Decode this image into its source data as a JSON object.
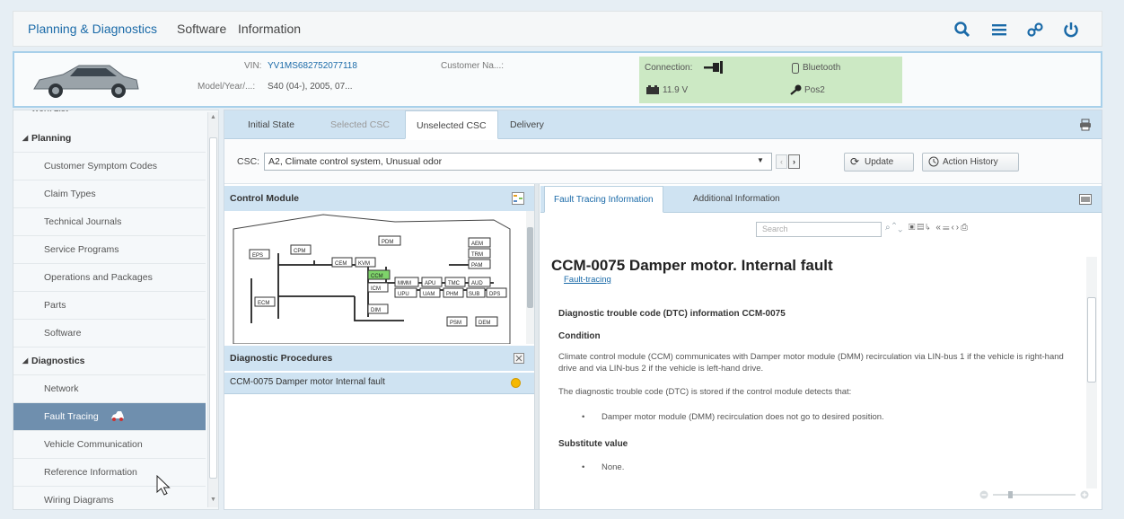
{
  "topbar": {
    "menu": [
      "Planning & Diagnostics",
      "Software",
      "Information"
    ]
  },
  "vehicle": {
    "vin_label": "VIN:",
    "vin": "YV1MS682752077118",
    "model_label": "Model/Year/...:",
    "model": "S40 (04-), 2005, 07...",
    "customer_label": "Customer Na...:",
    "connection_label": "Connection:",
    "bluetooth": "Bluetooth",
    "voltage": "11.9 V",
    "ignition": "Pos2"
  },
  "sidebar": {
    "top_cut": "Work List",
    "planning": "Planning",
    "planning_items": [
      "Customer Symptom Codes",
      "Claim Types",
      "Technical Journals",
      "Service Programs",
      "Operations and Packages",
      "Parts",
      "Software"
    ],
    "diagnostics": "Diagnostics",
    "diagnostics_items": [
      "Network",
      "Fault Tracing",
      "Vehicle Communication",
      "Reference Information",
      "Wiring Diagrams"
    ]
  },
  "tabs": [
    "Initial State",
    "Selected CSC",
    "Unselected CSC",
    "Delivery"
  ],
  "csc": {
    "label": "CSC:",
    "value": "A2, Climate control system, Unusual odor",
    "update": "Update",
    "action_history": "Action History"
  },
  "control_module": {
    "title": "Control Module",
    "modules": [
      "EPS",
      "CPM",
      "CEM",
      "ICM",
      "PDM",
      "KVM",
      "CCM",
      "ICM",
      "DIM",
      "ECM",
      "AEM",
      "TRM",
      "PAM",
      "AUD",
      "MMM",
      "UPU",
      "PSM",
      "DEM",
      "APU",
      "TMC",
      "UAM",
      "PHM",
      "SUB",
      "DPS"
    ]
  },
  "diagnostic_procedures": {
    "title": "Diagnostic Procedures",
    "items": [
      "CCM-0075 Damper motor Internal fault"
    ],
    "status_color": "#f5b800"
  },
  "fault_info": {
    "tabs": [
      "Fault Tracing Information",
      "Additional Information"
    ],
    "search_placeholder": "Search",
    "title": "CCM-0075 Damper motor. Internal fault",
    "link": "Fault-tracing",
    "dtc_heading": "Diagnostic trouble code (DTC) information CCM-0075",
    "condition_heading": "Condition",
    "condition_text": "Climate control module (CCM) communicates with Damper motor module (DMM) recirculation via LIN-bus 1 if the vehicle is right-hand drive and via LIN-bus 2 if the vehicle is left-hand drive.",
    "stored_text": "The diagnostic trouble code (DTC) is stored if the control module detects that:",
    "bullet1": "Damper motor module (DMM) recirculation does not go to desired position.",
    "substitute_heading": "Substitute value",
    "bullet2": "None."
  },
  "colors": {
    "accent": "#1a6aa8",
    "tabbar": "#cfe3f2",
    "connection_bg": "#cce9c4",
    "selected_item": "#6f8fae",
    "module_green": "#7ed36a"
  }
}
